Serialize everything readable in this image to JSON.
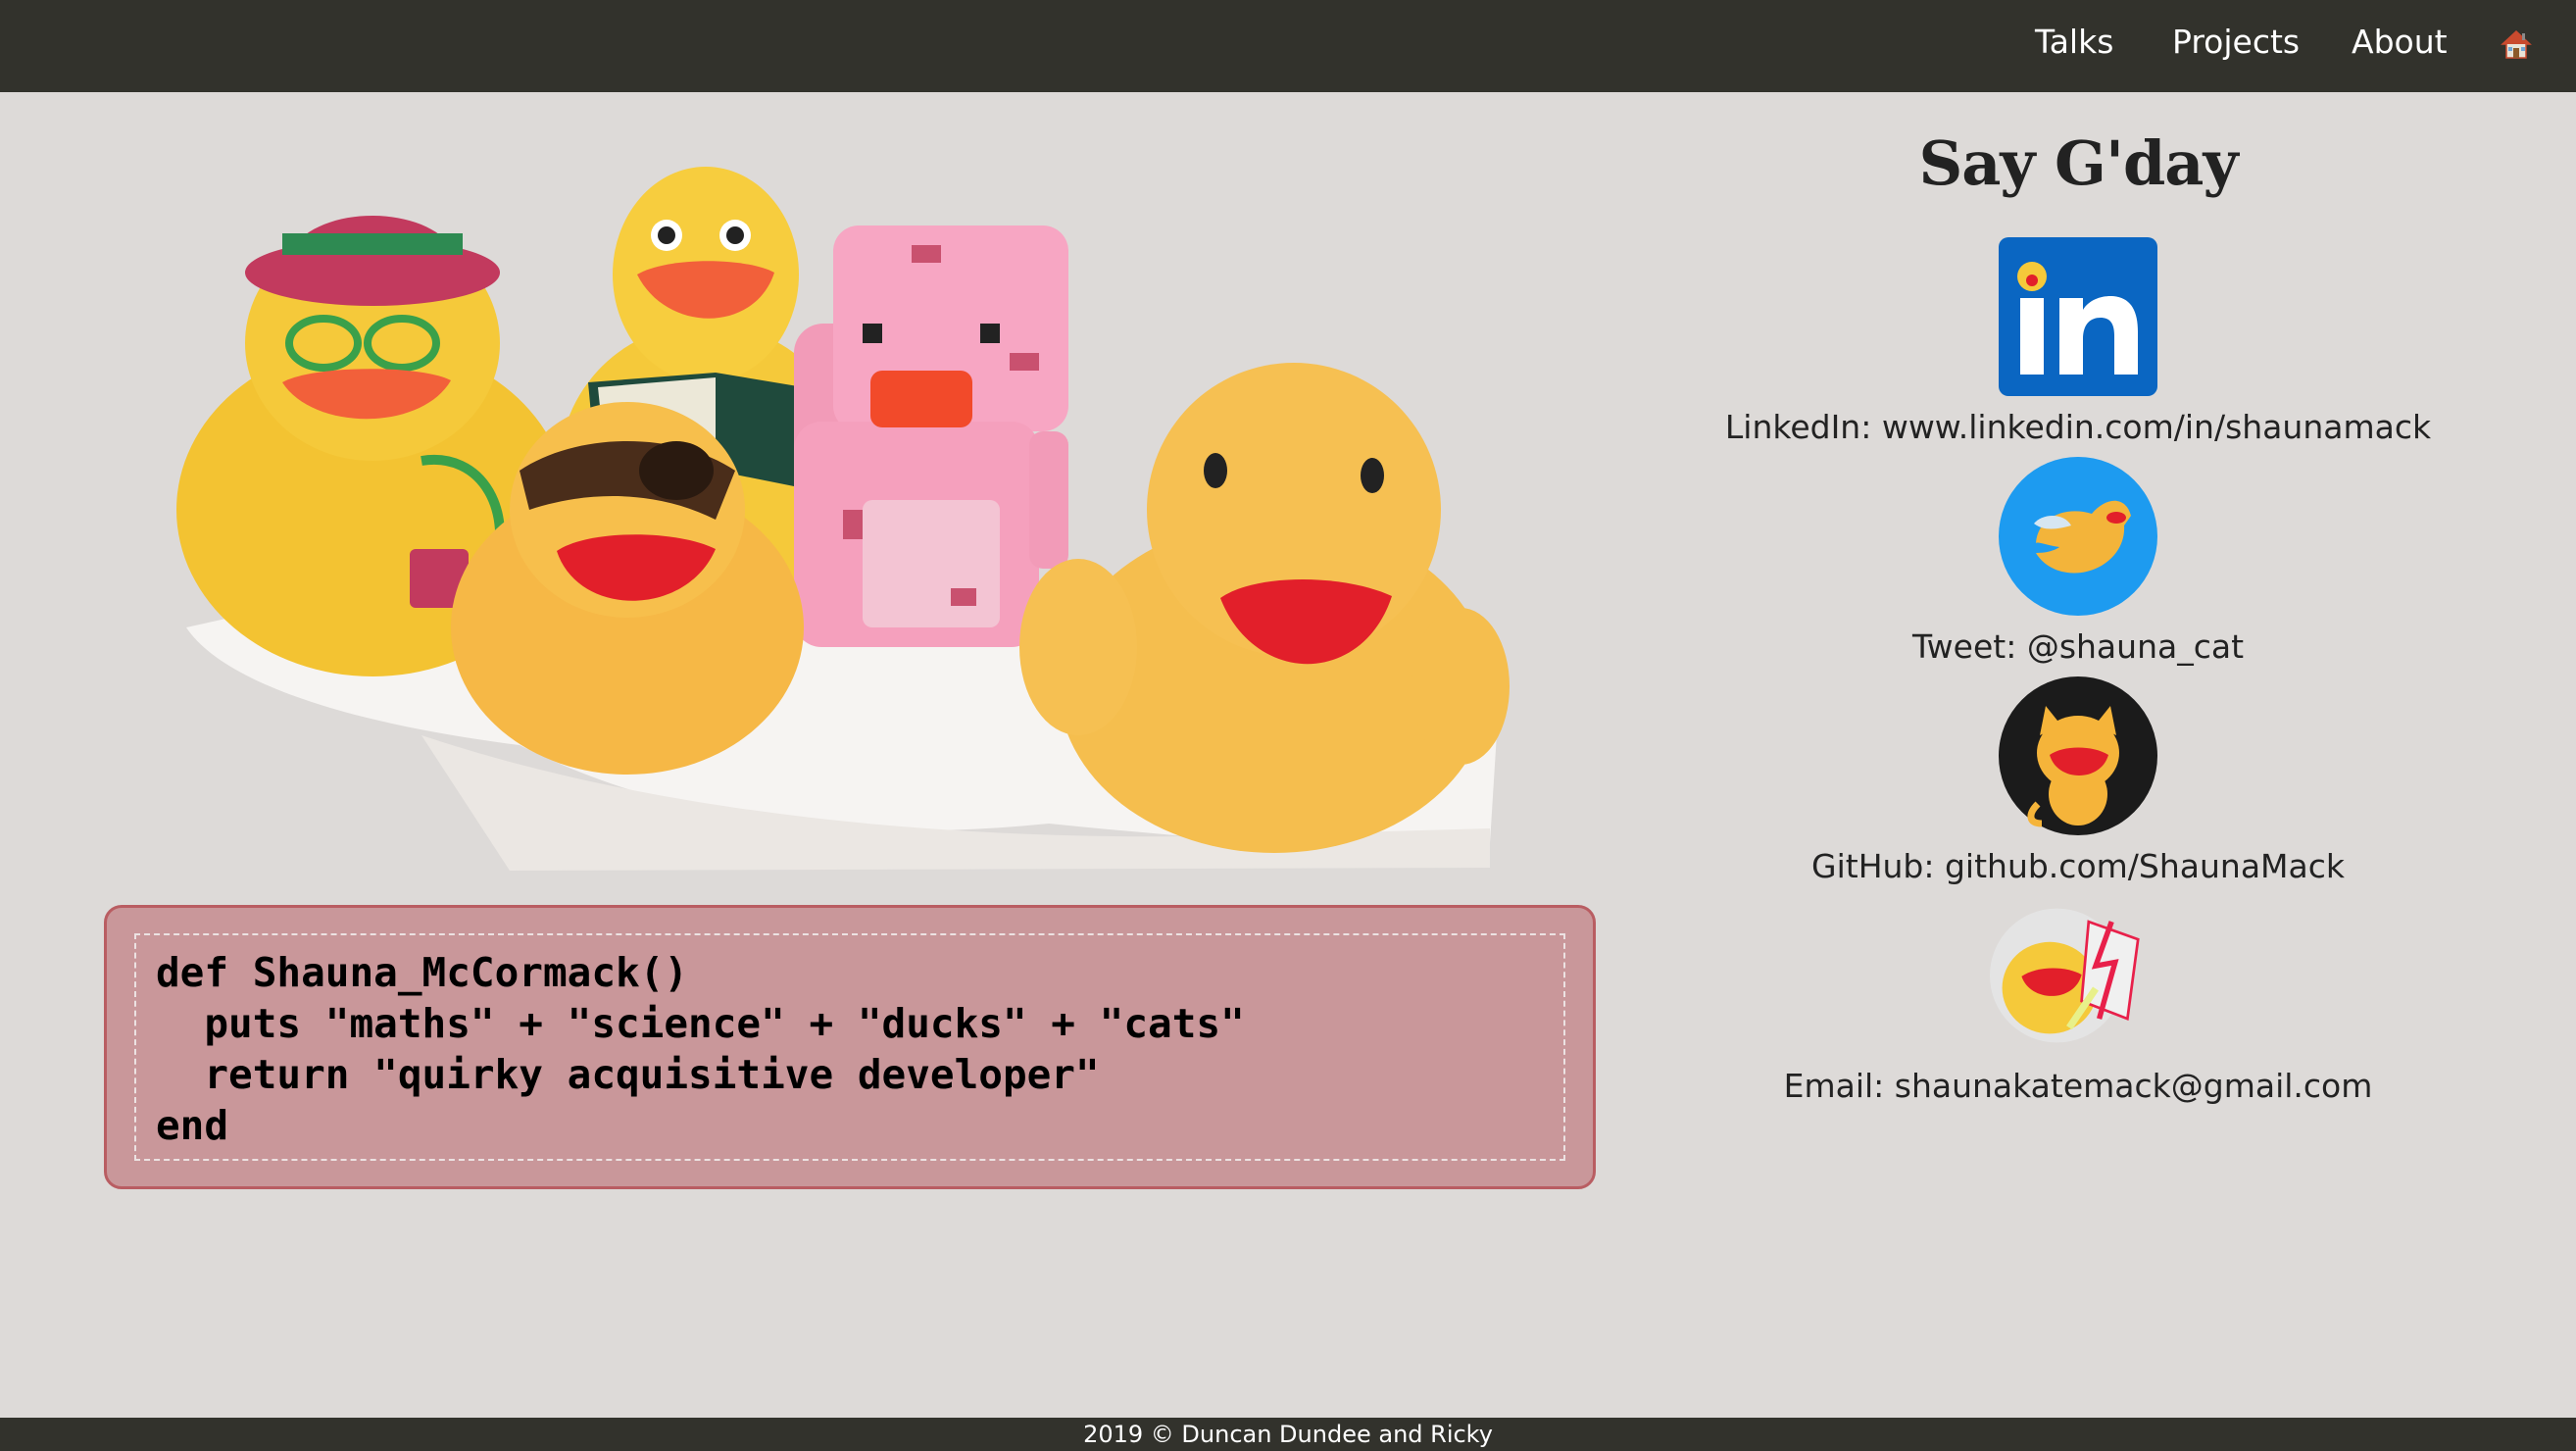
{
  "nav": {
    "talks": "Talks",
    "projects": "Projects",
    "about": "About",
    "home_icon": "house-icon"
  },
  "code": {
    "line1": "def Shauna_McCormack()",
    "line2": "  puts \"maths\" + \"science\" + \"ducks\" + \"cats\"",
    "line3": "  return \"quirky acquisitive developer\"",
    "line4": "end"
  },
  "sidebar": {
    "title": "Say G'day",
    "linkedin": "LinkedIn: www.linkedin.com/in/shaunamack",
    "twitter": "Tweet: @shauna_cat",
    "github": "GitHub: github.com/ShaunaMack",
    "email": "Email: shaunakatemack@gmail.com",
    "linkedin_icon": "linkedin-icon",
    "twitter_icon": "twitter-icon",
    "github_icon": "github-icon",
    "email_icon": "email-icon"
  },
  "footer": {
    "text": "2019 © Duncan Dundee and Ricky"
  },
  "colors": {
    "nav_bg": "#32322c",
    "page_bg": "#dddad8",
    "code_bg": "#c9979a",
    "code_border": "#b95d62",
    "linkedin_blue": "#0a66c2",
    "twitter_blue": "#1d9bf0"
  }
}
